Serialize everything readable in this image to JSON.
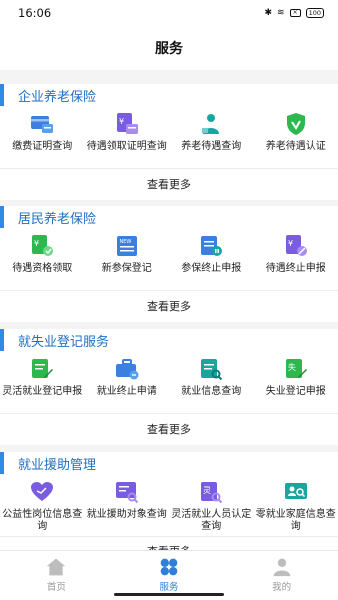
{
  "status_bar": {
    "time": "16:06",
    "battery": "100"
  },
  "header": {
    "title": "服务"
  },
  "sections": [
    {
      "title": "企业养老保险",
      "items": [
        {
          "label": "缴费证明查询",
          "icon": "payment-proof-icon"
        },
        {
          "label": "待遇领取证明查询",
          "icon": "benefit-certificate-icon"
        },
        {
          "label": "养老待遇查询",
          "icon": "pension-elder-icon"
        },
        {
          "label": "养老待遇认证",
          "icon": "verification-shield-icon"
        }
      ],
      "more": "查看更多"
    },
    {
      "title": "居民养老保险",
      "items": [
        {
          "label": "待遇资格领取",
          "icon": "benefit-qualification-icon"
        },
        {
          "label": "新参保登记",
          "icon": "new-enrollment-icon"
        },
        {
          "label": "参保终止申报",
          "icon": "enrollment-stop-icon"
        },
        {
          "label": "待遇终止申报",
          "icon": "benefit-stop-icon"
        }
      ],
      "more": "查看更多"
    },
    {
      "title": "就失业登记服务",
      "items": [
        {
          "label": "灵活就业登记申报",
          "icon": "flexible-employment-icon"
        },
        {
          "label": "就业终止申请",
          "icon": "briefcase-icon"
        },
        {
          "label": "就业信息查询",
          "icon": "employment-info-icon"
        },
        {
          "label": "失业登记申报",
          "icon": "unemployment-register-icon"
        }
      ],
      "more": "查看更多"
    },
    {
      "title": "就业援助管理",
      "items": [
        {
          "label": "公益性岗位信息查询",
          "icon": "public-welfare-heart-icon"
        },
        {
          "label": "就业援助对象查询",
          "icon": "assistance-search-icon"
        },
        {
          "label": "灵活就业人员认定查询",
          "icon": "flexible-personnel-icon"
        },
        {
          "label": "零就业家庭信息查询",
          "icon": "zero-employment-family-icon"
        }
      ],
      "more": "查看更多"
    }
  ],
  "tabs": [
    {
      "label": "首页",
      "icon": "home-icon",
      "active": false
    },
    {
      "label": "服务",
      "icon": "services-grid-icon",
      "active": true
    },
    {
      "label": "我的",
      "icon": "profile-icon",
      "active": false
    }
  ],
  "colors": {
    "accent": "#2f7fd9",
    "icon_blue": "#3b7fe0",
    "icon_purple": "#7a5ce0",
    "icon_teal": "#1aa6a0",
    "icon_green": "#2cb84f"
  }
}
